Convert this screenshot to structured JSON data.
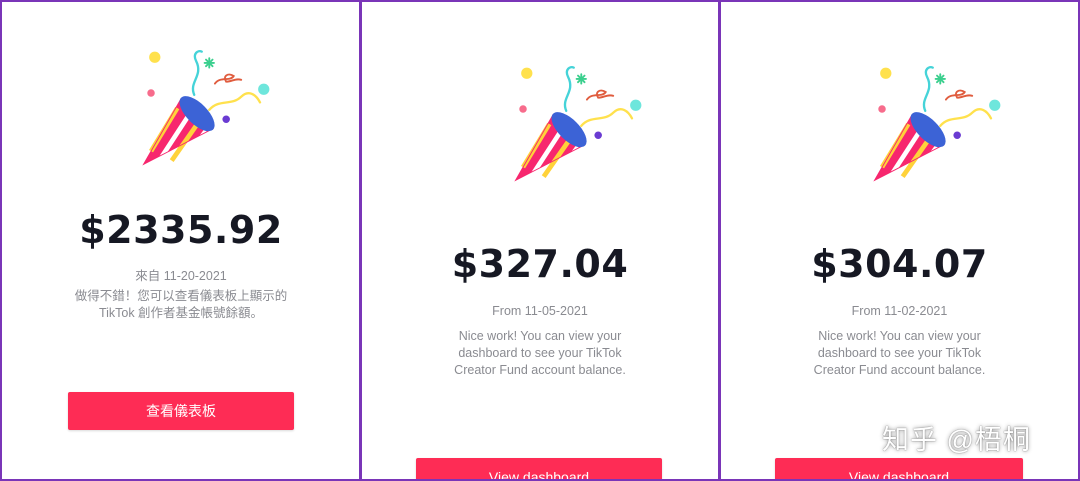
{
  "colors": {
    "border": "#7a35b8",
    "button": "#fe2c55",
    "amount_text": "#161823",
    "secondary_text": "#8a8b91"
  },
  "panels": [
    {
      "amount": "$2335.92",
      "date": "來自 11-20-2021",
      "message_lines": [
        "做得不錯！您可以查看儀表板上顯示的",
        "TikTok 創作者基金帳號餘額。"
      ],
      "button_label": "查看儀表板",
      "icon": "party-popper-icon"
    },
    {
      "amount": "$327.04",
      "date": "From 11-05-2021",
      "message_lines": [
        "Nice work! You can view your",
        "dashboard to see your TikTok",
        "Creator Fund account balance."
      ],
      "button_label": "View dashboard",
      "icon": "party-popper-icon"
    },
    {
      "amount": "$304.07",
      "date": "From 11-02-2021",
      "message_lines": [
        "Nice work! You can view your",
        "dashboard to see your TikTok",
        "Creator Fund account balance."
      ],
      "button_label": "View dashboard",
      "icon": "party-popper-icon"
    }
  ],
  "watermark": "知乎 @梧桐"
}
